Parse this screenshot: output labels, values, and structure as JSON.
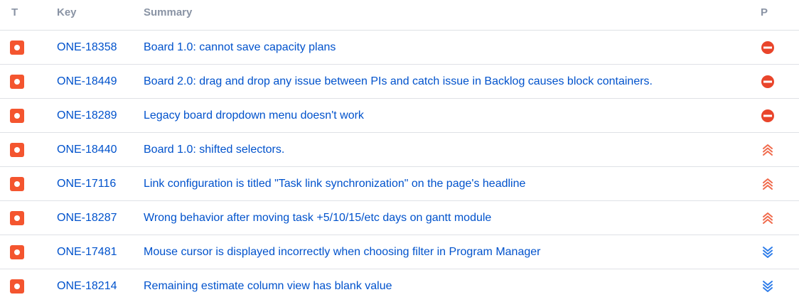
{
  "headers": {
    "type": "T",
    "key": "Key",
    "summary": "Summary",
    "priority": "P"
  },
  "colors": {
    "bug": "#f4552f",
    "blocker": "#e9452b",
    "highest": "#f06a4c",
    "lowest": "#2f7de9",
    "link": "#0052cc"
  },
  "rows": [
    {
      "type_icon": "bug-icon",
      "key": "ONE-18358",
      "summary": "Board 1.0: cannot save capacity plans",
      "priority": "blocker"
    },
    {
      "type_icon": "bug-icon",
      "key": "ONE-18449",
      "summary": "Board 2.0: drag and drop any issue between PIs and catch issue in Backlog causes block containers.",
      "priority": "blocker"
    },
    {
      "type_icon": "bug-icon",
      "key": "ONE-18289",
      "summary": "Legacy board dropdown menu doesn't work",
      "priority": "blocker"
    },
    {
      "type_icon": "bug-icon",
      "key": "ONE-18440",
      "summary": "Board 1.0: shifted selectors.",
      "priority": "highest"
    },
    {
      "type_icon": "bug-icon",
      "key": "ONE-17116",
      "summary": "Link configuration is titled \"Task link synchronization\" on the page's headline",
      "priority": "highest"
    },
    {
      "type_icon": "bug-icon",
      "key": "ONE-18287",
      "summary": "Wrong behavior after moving task +5/10/15/etc days on gantt module",
      "priority": "highest"
    },
    {
      "type_icon": "bug-icon",
      "key": "ONE-17481",
      "summary": "Mouse cursor is displayed incorrectly when choosing filter in Program Manager",
      "priority": "lowest"
    },
    {
      "type_icon": "bug-icon",
      "key": "ONE-18214",
      "summary": "Remaining estimate column view has blank value",
      "priority": "lowest"
    }
  ]
}
